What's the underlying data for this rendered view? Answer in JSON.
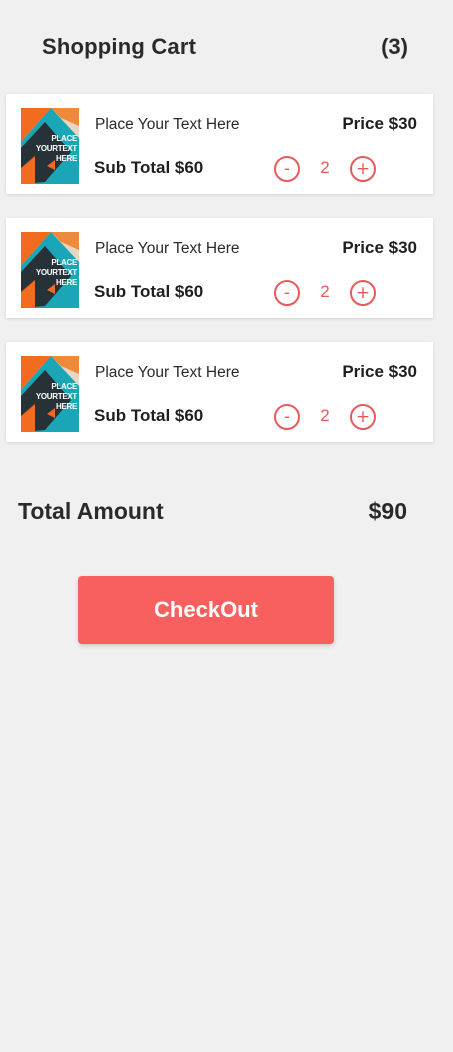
{
  "header": {
    "title": "Shopping Cart",
    "count": "(3)"
  },
  "thumbnail": {
    "line1": "PLACE",
    "line2": "YOURTEXT",
    "line3": "HERE",
    "colors": {
      "orange": "#f26b1f",
      "teal": "#1aa6b7",
      "dark": "#263238",
      "beige": "#e8d6c2"
    }
  },
  "items": [
    {
      "description": "Place Your Text Here",
      "price": "Price $30",
      "subtotal": "Sub Total $60",
      "quantity": "2",
      "minus": "-",
      "plus": "+"
    },
    {
      "description": "Place Your Text Here",
      "price": "Price $30",
      "subtotal": "Sub Total $60",
      "quantity": "2",
      "minus": "-",
      "plus": "+"
    },
    {
      "description": "Place Your Text Here",
      "price": "Price $30",
      "subtotal": "Sub Total $60",
      "quantity": "2",
      "minus": "-",
      "plus": "+"
    }
  ],
  "total": {
    "label": "Total Amount",
    "value": "$90"
  },
  "checkout": {
    "label": "CheckOut"
  },
  "colors": {
    "accent": "#f85f5f",
    "background": "#f0f0f0"
  }
}
